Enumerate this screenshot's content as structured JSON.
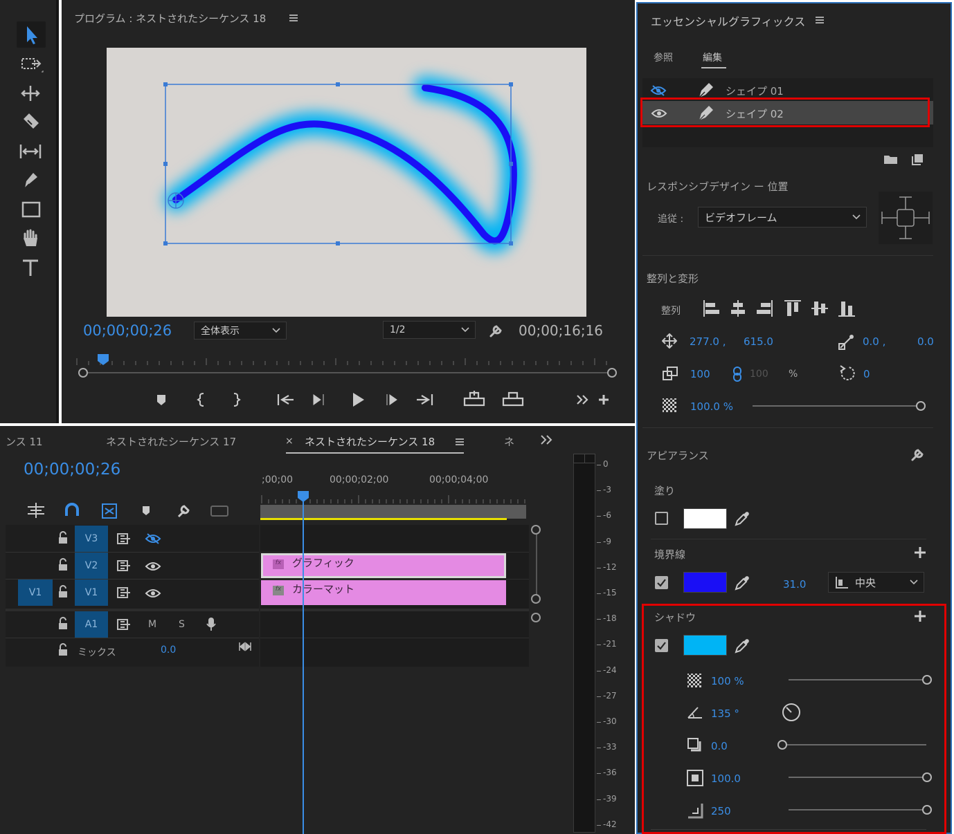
{
  "program": {
    "title": "プログラム : ネストされたシーケンス 18",
    "timecode": "00;00;00;26",
    "zoom": "全体表示",
    "quality": "1/2",
    "duration": "00;00;16;16"
  },
  "timeline": {
    "tabs": [
      "ンス 11",
      "ネストされたシーケンス 17",
      "ネストされたシーケンス 18",
      "ネ"
    ],
    "active_tab_index": 2,
    "timecode": "00;00;00;26",
    "ruler": [
      ";00;00",
      "00;00;02;00",
      "00;00;04;00"
    ],
    "tracks": {
      "v3": "V3",
      "v2": "V2",
      "v1": "V1",
      "v1_src": "V1",
      "a1": "A1",
      "mute": "M",
      "solo": "S",
      "mix_label": "ミックス",
      "mix_value": "0.0"
    },
    "clips": {
      "graphic": "グラフィック",
      "matte": "カラーマット"
    }
  },
  "meter": {
    "labels": [
      "0",
      "-3",
      "-6",
      "-9",
      "-12",
      "-15",
      "-18",
      "-21",
      "-24",
      "-27",
      "-30",
      "-33",
      "-36",
      "-39",
      "-42"
    ]
  },
  "eg": {
    "title": "エッセンシャルグラフィックス",
    "tab_browse": "参照",
    "tab_edit": "編集",
    "layers": [
      "シェイプ 01",
      "シェイプ 02"
    ],
    "responsive_title": "レスポンシブデザイン ー 位置",
    "follow_label": "追従 :",
    "follow_value": "ビデオフレーム",
    "align_title": "整列と変形",
    "align_label": "整列",
    "pos_x": "277.0 ,",
    "pos_y": "615.0",
    "anchor_x": "0.0 ,",
    "anchor_y": "0.0",
    "scale": "100",
    "scale_h": "100",
    "percent": "%",
    "rotation": "0",
    "opacity": "100.0 %",
    "opacity_value": 1.0,
    "appearance_title": "アピアランス",
    "fill_label": "塗り",
    "fill_color": "#ffffff",
    "stroke_label": "境界線",
    "stroke_color": "#1a0ff5",
    "stroke_width": "31.0",
    "stroke_align": "中央",
    "shadow_label": "シャドウ",
    "shadow_color": "#00b4f5",
    "shadow_opacity": "100 %",
    "shadow_opacity_value": 1.0,
    "shadow_angle": "135 °",
    "shadow_distance": "0.0",
    "shadow_distance_value": 0.0,
    "shadow_size": "100.0",
    "shadow_size_value": 1.0,
    "shadow_blur": "250",
    "shadow_blur_value": 1.0
  },
  "colors": {
    "accent": "#3a8ee6",
    "clip": "#e48ae3",
    "highlight": "#e00000",
    "shape_stroke": "#1a0ff5",
    "glow": "#00b4f5"
  }
}
